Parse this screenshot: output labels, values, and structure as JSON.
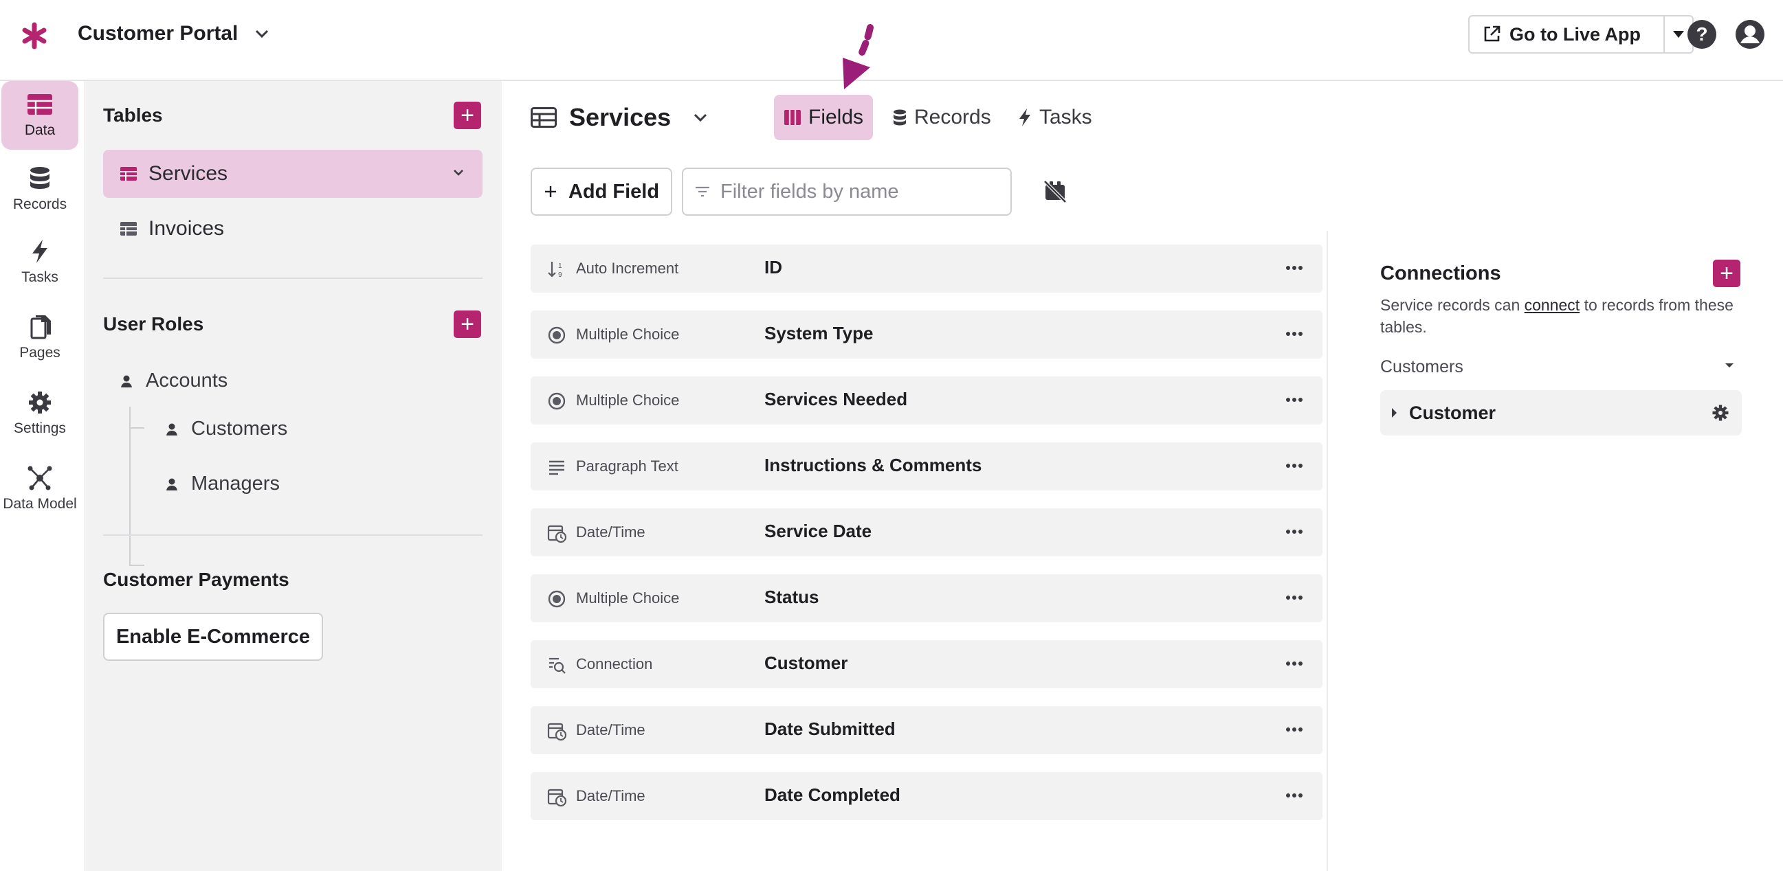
{
  "header": {
    "app_title": "Customer Portal",
    "live_app_label": "Go to Live App"
  },
  "rail": [
    {
      "label": "Data",
      "icon": "table-icon",
      "active": true
    },
    {
      "label": "Records",
      "icon": "database-icon"
    },
    {
      "label": "Tasks",
      "icon": "bolt-icon"
    },
    {
      "label": "Pages",
      "icon": "pages-icon"
    },
    {
      "label": "Settings",
      "icon": "gear-icon"
    },
    {
      "label": "Data Model",
      "icon": "data-model-icon"
    }
  ],
  "sidebar": {
    "tables_heading": "Tables",
    "tables": [
      {
        "label": "Services",
        "active": true
      },
      {
        "label": "Invoices"
      }
    ],
    "roles_heading": "User Roles",
    "roles": {
      "parent": "Accounts",
      "children": [
        "Customers",
        "Managers"
      ]
    },
    "payments_heading": "Customer Payments",
    "ecommerce_label": "Enable E-Commerce"
  },
  "main": {
    "title": "Services",
    "tabs": [
      {
        "label": "Fields",
        "active": true
      },
      {
        "label": "Records"
      },
      {
        "label": "Tasks"
      }
    ],
    "add_field_label": "Add Field",
    "filter_placeholder": "Filter fields by name",
    "fields": [
      {
        "type": "Auto Increment",
        "name": "ID",
        "icon": "auto-increment-icon"
      },
      {
        "type": "Multiple Choice",
        "name": "System Type",
        "icon": "radio-icon"
      },
      {
        "type": "Multiple Choice",
        "name": "Services Needed",
        "icon": "radio-icon"
      },
      {
        "type": "Paragraph Text",
        "name": "Instructions & Comments",
        "icon": "paragraph-icon"
      },
      {
        "type": "Date/Time",
        "name": "Service Date",
        "icon": "calendar-clock-icon"
      },
      {
        "type": "Multiple Choice",
        "name": "Status",
        "icon": "radio-icon"
      },
      {
        "type": "Connection",
        "name": "Customer",
        "icon": "connection-icon"
      },
      {
        "type": "Date/Time",
        "name": "Date Submitted",
        "icon": "calendar-clock-icon"
      },
      {
        "type": "Date/Time",
        "name": "Date Completed",
        "icon": "calendar-clock-icon"
      }
    ]
  },
  "connections": {
    "title": "Connections",
    "desc_prefix": "Service records can ",
    "desc_link": "connect",
    "desc_suffix": " to records from these tables.",
    "group_label": "Customers",
    "items": [
      {
        "label": "Customer"
      }
    ]
  },
  "colors": {
    "accent": "#b5246e",
    "accent_light": "#ebc9e0",
    "sidebar_bg": "#f2f2f2"
  }
}
